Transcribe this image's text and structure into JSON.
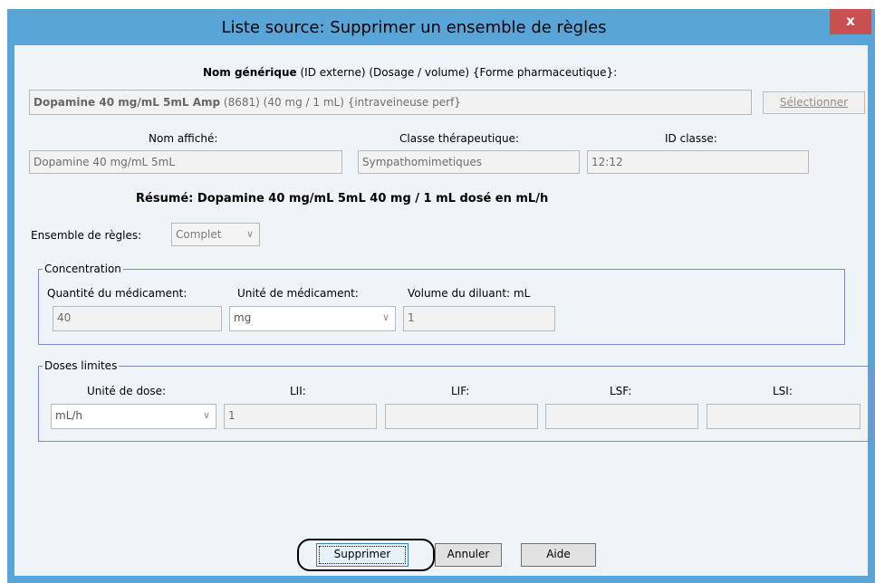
{
  "window": {
    "title": "Liste source:  Supprimer un ensemble de règles",
    "close_label": "x"
  },
  "generic": {
    "heading_bold": "Nom générique",
    "heading_rest": " (ID externe) (Dosage / volume) {Forme pharmaceutique}:",
    "value_bold": "Dopamine 40 mg/mL 5mL Amp",
    "value_rest": " (8681) (40 mg / 1 mL) {intraveineuse perf}",
    "select_button": "Sélectionner"
  },
  "display_name": {
    "label": "Nom affiché:",
    "value": "Dopamine 40 mg/mL  5mL"
  },
  "therapeutic_class": {
    "label": "Classe thérapeutique:",
    "value": "Sympathomimetiques"
  },
  "class_id": {
    "label": "ID classe:",
    "value": "12:12"
  },
  "summary": "Résumé: Dopamine 40 mg/mL  5mL 40 mg / 1 mL dosé en mL/h",
  "rule_set": {
    "label": "Ensemble de règles:",
    "value": "Complet"
  },
  "concentration": {
    "legend": "Concentration",
    "drug_amount": {
      "label": "Quantité du médicament:",
      "value": "40"
    },
    "drug_unit": {
      "label": "Unité de médicament:",
      "value": "mg"
    },
    "diluent_volume": {
      "label": "Volume du diluant: mL",
      "value": "1"
    }
  },
  "dose_limits": {
    "legend": "Doses limites",
    "dose_unit": {
      "label": "Unité de dose:",
      "value": "mL/h"
    },
    "lii": {
      "label": "LII:",
      "value": "1"
    },
    "lif": {
      "label": "LIF:",
      "value": ""
    },
    "lsf": {
      "label": "LSF:",
      "value": ""
    },
    "lsi": {
      "label": "LSI:",
      "value": ""
    }
  },
  "buttons": {
    "delete": "Supprimer",
    "cancel": "Annuler",
    "help": "Aide"
  }
}
